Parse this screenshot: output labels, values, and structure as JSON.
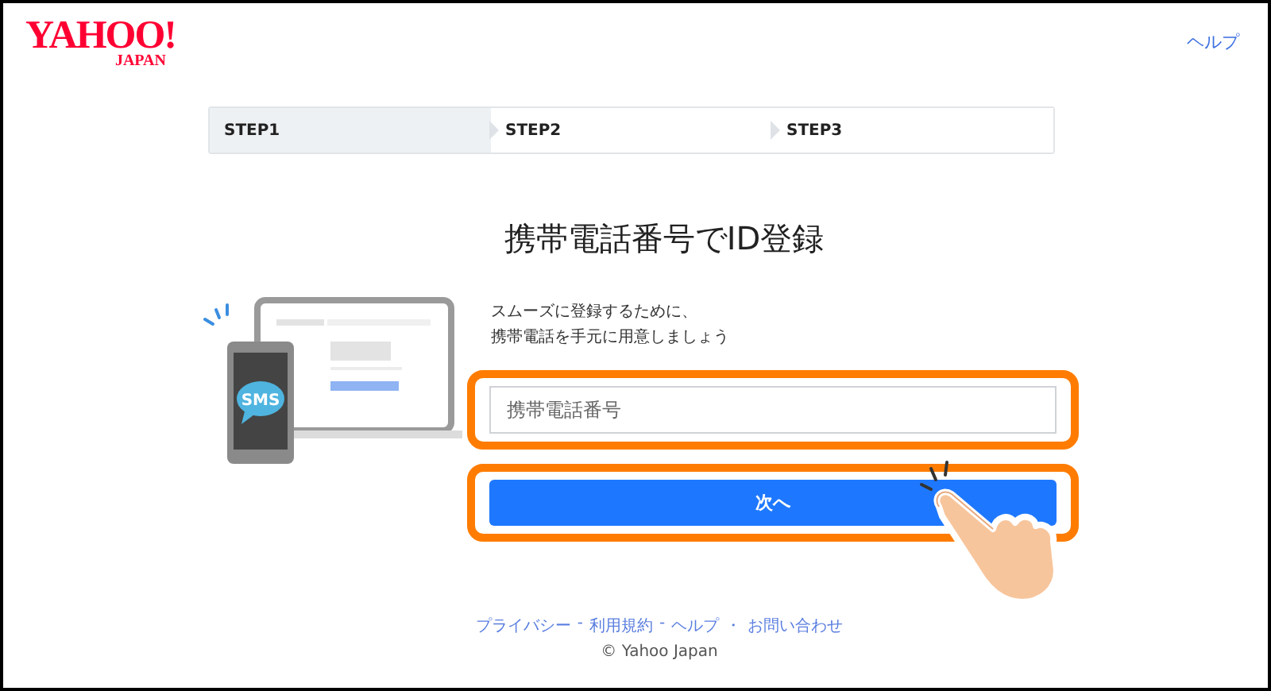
{
  "header": {
    "logo": {
      "main": "YAHOO!",
      "sub": "JAPAN"
    },
    "help_link": "ヘルプ"
  },
  "steps": [
    {
      "label": "STEP1",
      "selected": true
    },
    {
      "label": "STEP2",
      "selected": false
    },
    {
      "label": "STEP3",
      "selected": false
    }
  ],
  "title": "携帯電話番号でID登録",
  "illustration": {
    "bubble_text": "SMS"
  },
  "instructions": [
    "スムーズに登録するために、",
    "携帯電話を手元に用意しましょう"
  ],
  "phone_field": {
    "placeholder": "携帯電話番号",
    "highlighted": true
  },
  "next_button": {
    "label": "次へ",
    "highlighted": true
  },
  "footer": {
    "links": [
      {
        "text": "プライバシー",
        "separator": "-"
      },
      {
        "text": "利用規約",
        "separator": "-"
      },
      {
        "text": "ヘルプ",
        "separator": "・"
      },
      {
        "text": "お問い合わせ"
      }
    ],
    "copyright": "© Yahoo Japan"
  }
}
